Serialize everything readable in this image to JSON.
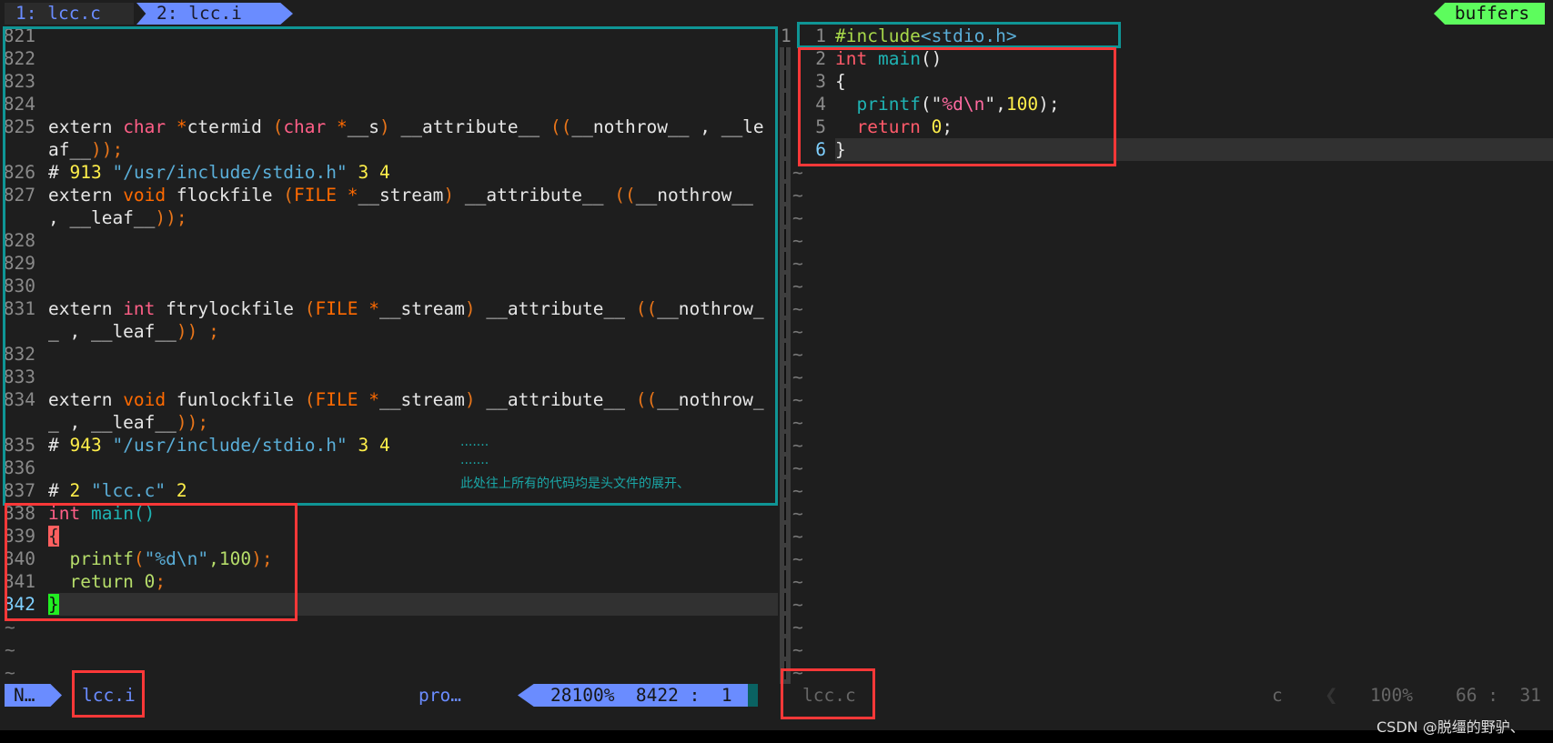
{
  "tabs": [
    {
      "label": "1: lcc.c"
    },
    {
      "label": "2: lcc.i"
    }
  ],
  "buffers_label": "buffers",
  "left_pane": {
    "rows": [
      {
        "ln": "821",
        "tokens": []
      },
      {
        "ln": "822",
        "tokens": []
      },
      {
        "ln": "823",
        "tokens": []
      },
      {
        "ln": "824",
        "tokens": []
      },
      {
        "ln": "825",
        "tokens": [
          [
            "extern ",
            "white"
          ],
          [
            "char",
            "pink"
          ],
          [
            " *",
            "orange"
          ],
          [
            "ctermid ",
            "white"
          ],
          [
            "(",
            "paren"
          ],
          [
            "char",
            "pink"
          ],
          [
            " *",
            "orange"
          ],
          [
            "__s",
            "white"
          ],
          [
            ")",
            "paren"
          ],
          [
            " __attribute__ ",
            "white"
          ],
          [
            "((",
            "paren"
          ],
          [
            "__nothrow__ , __le",
            "white"
          ]
        ]
      },
      {
        "ln": "",
        "tokens": [
          [
            "af__",
            "white"
          ],
          [
            "));",
            "paren"
          ]
        ]
      },
      {
        "ln": "826",
        "tokens": [
          [
            "# ",
            "white"
          ],
          [
            "913",
            "num"
          ],
          [
            " \"/usr/include/stdio.h\"",
            "path"
          ],
          [
            " 3 4",
            "num"
          ]
        ]
      },
      {
        "ln": "827",
        "tokens": [
          [
            "extern ",
            "white"
          ],
          [
            "void",
            "orange"
          ],
          [
            " flockfile ",
            "white"
          ],
          [
            "(",
            "paren"
          ],
          [
            "FILE",
            "orange"
          ],
          [
            " *",
            "orange"
          ],
          [
            "__stream",
            "white"
          ],
          [
            ")",
            "paren"
          ],
          [
            " __attribute__ ",
            "white"
          ],
          [
            "((",
            "paren"
          ],
          [
            "__nothrow__",
            "white"
          ]
        ]
      },
      {
        "ln": "",
        "tokens": [
          [
            ", __leaf__",
            "white"
          ],
          [
            "));",
            "paren"
          ]
        ]
      },
      {
        "ln": "828",
        "tokens": []
      },
      {
        "ln": "829",
        "tokens": []
      },
      {
        "ln": "830",
        "tokens": []
      },
      {
        "ln": "831",
        "tokens": [
          [
            "extern ",
            "white"
          ],
          [
            "int",
            "pink"
          ],
          [
            " ftrylockfile ",
            "white"
          ],
          [
            "(",
            "paren"
          ],
          [
            "FILE",
            "orange"
          ],
          [
            " *",
            "orange"
          ],
          [
            "__stream",
            "white"
          ],
          [
            ")",
            "paren"
          ],
          [
            " __attribute__ ",
            "white"
          ],
          [
            "((",
            "paren"
          ],
          [
            "__nothrow_",
            "white"
          ]
        ]
      },
      {
        "ln": "",
        "tokens": [
          [
            "_ , __leaf__",
            "white"
          ],
          [
            ")) ;",
            "paren"
          ]
        ]
      },
      {
        "ln": "832",
        "tokens": []
      },
      {
        "ln": "833",
        "tokens": []
      },
      {
        "ln": "834",
        "tokens": [
          [
            "extern ",
            "white"
          ],
          [
            "void",
            "orange"
          ],
          [
            " funlockfile ",
            "white"
          ],
          [
            "(",
            "paren"
          ],
          [
            "FILE",
            "orange"
          ],
          [
            " *",
            "orange"
          ],
          [
            "__stream",
            "white"
          ],
          [
            ")",
            "paren"
          ],
          [
            " __attribute__ ",
            "white"
          ],
          [
            "((",
            "paren"
          ],
          [
            "__nothrow_",
            "white"
          ]
        ]
      },
      {
        "ln": "",
        "tokens": [
          [
            "_ , __leaf__",
            "white"
          ],
          [
            "));",
            "paren"
          ]
        ]
      },
      {
        "ln": "835",
        "tokens": [
          [
            "# ",
            "white"
          ],
          [
            "943",
            "num"
          ],
          [
            " \"/usr/include/stdio.h\"",
            "path"
          ],
          [
            " 3 4",
            "num"
          ]
        ]
      },
      {
        "ln": "836",
        "tokens": []
      },
      {
        "ln": "837",
        "tokens": [
          [
            "# ",
            "white"
          ],
          [
            "2",
            "num"
          ],
          [
            " \"lcc.c\"",
            "path"
          ],
          [
            " 2",
            "num"
          ]
        ]
      },
      {
        "ln": "838",
        "tokens": [
          [
            "int",
            "pink"
          ],
          [
            " main",
            "teal"
          ],
          [
            "()",
            "teal"
          ]
        ]
      },
      {
        "ln": "839",
        "tokens": [
          [
            "{",
            "brace-red"
          ]
        ]
      },
      {
        "ln": "840",
        "tokens": [
          [
            "  printf",
            "green"
          ],
          [
            "(",
            "paren"
          ],
          [
            "\"%d\\n\"",
            "path"
          ],
          [
            ",100",
            "green"
          ],
          [
            ");",
            "paren"
          ]
        ]
      },
      {
        "ln": "841",
        "tokens": [
          [
            "  return 0",
            "green"
          ],
          [
            ";",
            "paren"
          ]
        ]
      },
      {
        "ln": "842",
        "tokens": [
          [
            "}",
            "brace-green"
          ]
        ]
      }
    ],
    "current_row": 25,
    "tilde_rows": 3,
    "annotation": {
      "dots1": ".......",
      "dots2": ".......",
      "text": "此处往上所有的代码均是头文件的展开、"
    },
    "status": {
      "mode": "N…",
      "filename": "lcc.i",
      "filetype": "pro…",
      "position": "28100%  8422 :  1"
    }
  },
  "right_pane": {
    "sign": "1",
    "rows": [
      {
        "ln": "1",
        "tokens": [
          [
            "#include",
            "incl"
          ],
          [
            "<stdio.h>",
            "path"
          ]
        ]
      },
      {
        "ln": "2",
        "tokens": [
          [
            "int",
            "red"
          ],
          [
            " main",
            "teal"
          ],
          [
            "()",
            "white"
          ]
        ]
      },
      {
        "ln": "3",
        "tokens": [
          [
            "{",
            "white"
          ]
        ]
      },
      {
        "ln": "4",
        "tokens": [
          [
            "  printf",
            "teal"
          ],
          [
            "(\"",
            "white"
          ],
          [
            "%d\\n",
            "strpink"
          ],
          [
            "\",",
            "white"
          ],
          [
            "100",
            "num"
          ],
          [
            ");",
            "white"
          ]
        ]
      },
      {
        "ln": "5",
        "tokens": [
          [
            "  return ",
            "red"
          ],
          [
            "0",
            "num"
          ],
          [
            ";",
            "white"
          ]
        ]
      },
      {
        "ln": "6",
        "tokens": [
          [
            "}",
            "white"
          ]
        ]
      }
    ],
    "current_row": 5,
    "tilde_rows": 23,
    "status": {
      "filename": "lcc.c",
      "filetype": "c",
      "percent": "100%",
      "position": "66 :  31"
    }
  },
  "watermark": "CSDN @脱缰的野驴、"
}
